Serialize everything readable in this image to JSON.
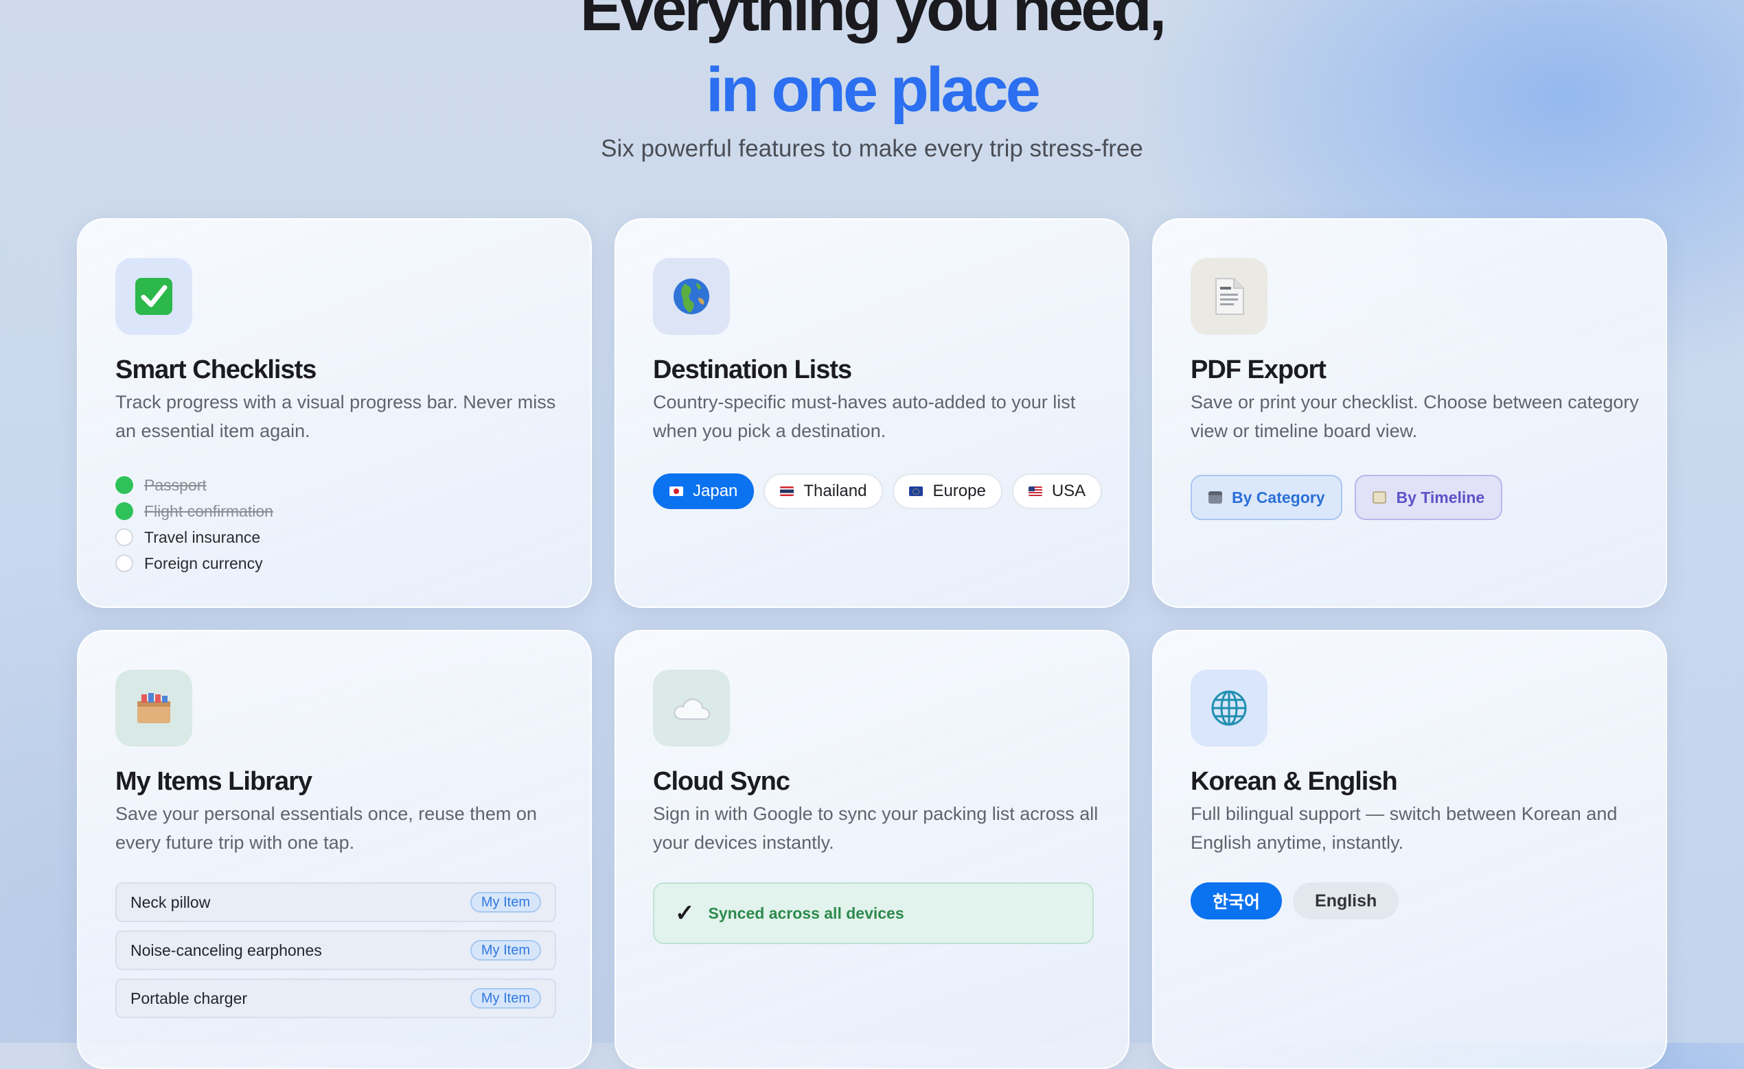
{
  "hero": {
    "title_line1": "Everything you need,",
    "title_line2": "in one place",
    "subtitle": "Six powerful features to make every trip stress-free"
  },
  "colors": {
    "accent": "#2c6ff0",
    "primary_button": "#0b72f0",
    "done_green": "#2fc25b",
    "sync_green": "#2d8a4d"
  },
  "features": [
    {
      "icon": "check-box-icon",
      "title": "Smart Checklists",
      "description": "Track progress with a visual progress bar. Never miss an essential item again.",
      "checklist": [
        {
          "label": "Passport",
          "done": true
        },
        {
          "label": "Flight confirmation",
          "done": true
        },
        {
          "label": "Travel insurance",
          "done": false
        },
        {
          "label": "Foreign currency",
          "done": false
        }
      ]
    },
    {
      "icon": "globe-icon",
      "title": "Destination Lists",
      "description": "Country-specific must-haves auto-added to your list when you pick a destination.",
      "destinations": [
        {
          "label": "Japan",
          "flag": "japan-flag-icon",
          "selected": true
        },
        {
          "label": "Thailand",
          "flag": "thailand-flag-icon",
          "selected": false
        },
        {
          "label": "Europe",
          "flag": "eu-flag-icon",
          "selected": false
        },
        {
          "label": "USA",
          "flag": "usa-flag-icon",
          "selected": false
        }
      ]
    },
    {
      "icon": "document-icon",
      "title": "PDF Export",
      "description": "Save or print your checklist. Choose between category view or timeline board view.",
      "views": [
        {
          "label": "By Category",
          "icon": "folder-icon"
        },
        {
          "label": "By Timeline",
          "icon": "notepad-icon"
        }
      ]
    },
    {
      "icon": "box-icon",
      "title": "My Items Library",
      "description": "Save your personal essentials once, reuse them on every future trip with one tap.",
      "items": [
        {
          "label": "Neck pillow",
          "tag": "My Item"
        },
        {
          "label": "Noise-canceling earphones",
          "tag": "My Item"
        },
        {
          "label": "Portable charger",
          "tag": "My Item"
        }
      ]
    },
    {
      "icon": "cloud-icon",
      "title": "Cloud Sync",
      "description": "Sign in with Google to sync your packing list across all your devices instantly.",
      "status": "Synced across all devices",
      "status_icon": "check-icon"
    },
    {
      "icon": "globe-grid-icon",
      "title": "Korean & English",
      "description": "Full bilingual support — switch between Korean and English anytime, instantly.",
      "languages": [
        {
          "label": "한국어",
          "selected": true
        },
        {
          "label": "English",
          "selected": false
        }
      ]
    }
  ]
}
